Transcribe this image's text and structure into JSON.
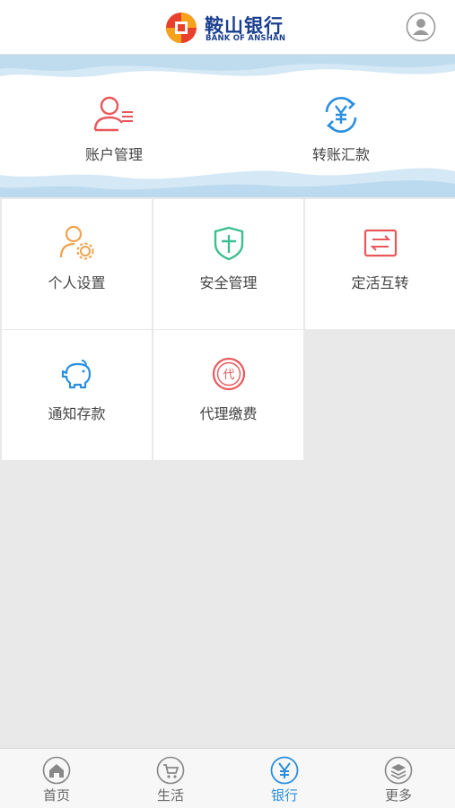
{
  "header": {
    "brand_cn": "鞍山银行",
    "brand_en": "BANK OF ANSHAN"
  },
  "hero": {
    "items": [
      {
        "label": "账户管理",
        "icon": "account-manage-icon"
      },
      {
        "label": "转账汇款",
        "icon": "transfer-yuan-icon"
      }
    ]
  },
  "grid": {
    "items": [
      {
        "label": "个人设置",
        "icon": "person-settings-icon"
      },
      {
        "label": "安全管理",
        "icon": "shield-icon"
      },
      {
        "label": "定活互转",
        "icon": "exchange-icon"
      },
      {
        "label": "通知存款",
        "icon": "piggy-bank-icon"
      },
      {
        "label": "代理缴费",
        "icon": "agent-pay-icon"
      }
    ]
  },
  "tabbar": {
    "active": "银行",
    "items": [
      {
        "label": "首页",
        "icon": "home-icon"
      },
      {
        "label": "生活",
        "icon": "cart-icon"
      },
      {
        "label": "银行",
        "icon": "yuan-icon"
      },
      {
        "label": "更多",
        "icon": "layers-icon"
      }
    ]
  },
  "colors": {
    "accent": "#2a8fe0",
    "brand_blue": "#1a3f8f",
    "icon_red": "#e8585b",
    "icon_orange": "#f0a24a",
    "icon_green": "#3cbf8f"
  }
}
